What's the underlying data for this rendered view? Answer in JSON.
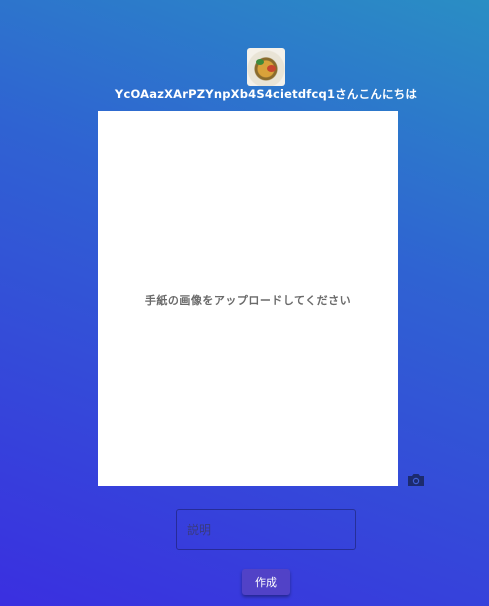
{
  "header": {
    "greeting": "YcOAazXArPZYnpXb4S4cietdfcq1さんこんにちは",
    "avatar": "user-avatar-food-photo"
  },
  "upload": {
    "prompt": "手紙の画像をアップロードしてください",
    "camera_icon": "camera-icon"
  },
  "form": {
    "description_placeholder": "説明",
    "description_value": "",
    "create_label": "作成"
  },
  "colors": {
    "background_top": "#2a8ec4",
    "background_bottom": "#3a2fe0",
    "button": "#5142c7",
    "panel": "#ffffff"
  }
}
